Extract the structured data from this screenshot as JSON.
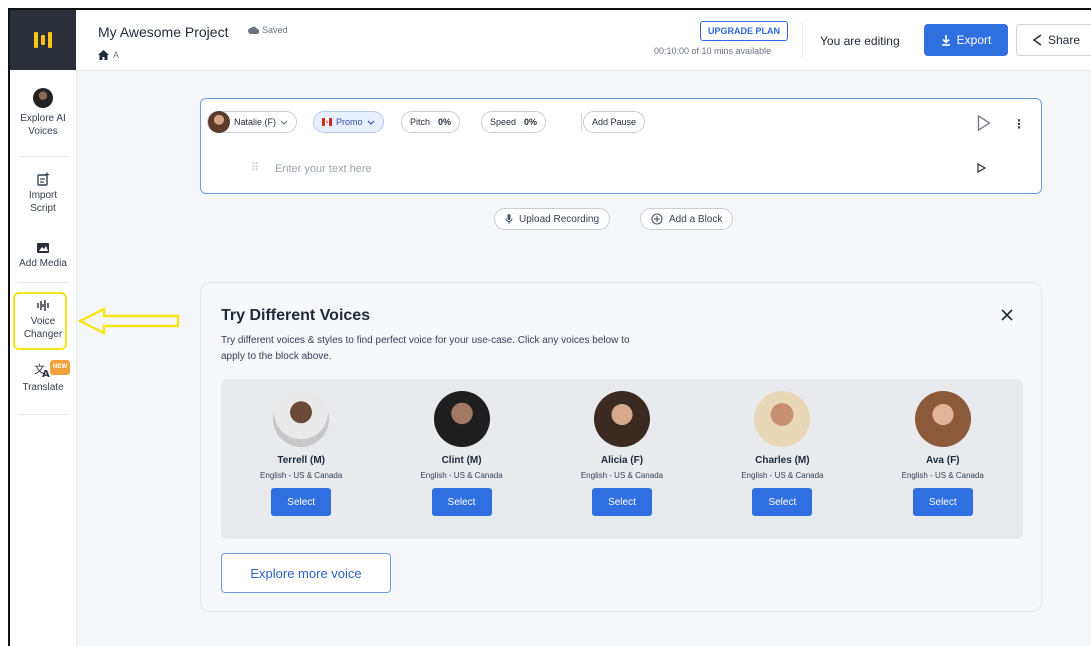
{
  "header": {
    "project_title": "My Awesome Project",
    "saved_label": "Saved",
    "breadcrumb_label": "A",
    "upgrade_label": "UPGRADE PLAN",
    "availability": "00:10:00 of 10 mins available",
    "editing_label": "You are editing",
    "export_label": "Export",
    "share_label": "Share"
  },
  "sidebar": {
    "items": [
      {
        "label": "Explore AI Voices",
        "icon": "voice-avatar-icon"
      },
      {
        "label": "Import Script",
        "icon": "import-script-icon"
      },
      {
        "label": "Add Media",
        "icon": "media-icon"
      },
      {
        "label": "Voice Changer",
        "icon": "voice-changer-icon"
      },
      {
        "label": "Translate",
        "icon": "translate-icon",
        "badge": "NEW"
      }
    ]
  },
  "editor": {
    "voice_name": "Natalie (F)",
    "style_label": "Promo",
    "pitch_label": "Pitch",
    "pitch_value": "0%",
    "speed_label": "Speed",
    "speed_value": "0%",
    "add_pause_label": "Add Pause",
    "text_placeholder": "Enter your text here",
    "upload_label": "Upload Recording",
    "add_block_label": "Add a Block"
  },
  "voices_panel": {
    "title": "Try Different Voices",
    "description": "Try different voices & styles to find perfect voice for your use-case. Click any voices below to apply to the block above.",
    "select_label": "Select",
    "explore_more_label": "Explore more voice",
    "voices": [
      {
        "name": "Terrell (M)",
        "lang": "English - US & Canada"
      },
      {
        "name": "Clint (M)",
        "lang": "English - US & Canada"
      },
      {
        "name": "Alicia (F)",
        "lang": "English - US & Canada"
      },
      {
        "name": "Charles (M)",
        "lang": "English - US & Canada"
      },
      {
        "name": "Ava (F)",
        "lang": "English - US & Canada"
      }
    ]
  },
  "colors": {
    "accent": "#2f6fe0",
    "highlight": "#f5e61a",
    "logo_bg": "#2a2f3a",
    "logo_fg": "#f5c518"
  }
}
